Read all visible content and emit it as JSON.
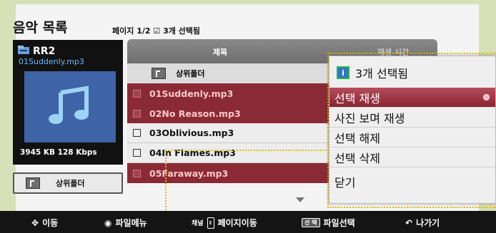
{
  "screen": {
    "title": "음악 목록",
    "page_info": "페이지 1/2",
    "selected_count": "3개 선택됨"
  },
  "now_playing": {
    "title": "RR2",
    "file": "01Suddenly.mp3",
    "info": "3945 KB 128 Kbps",
    "icon": "music-note-icon"
  },
  "up_button": {
    "label": "상위폴더"
  },
  "list": {
    "header_col1": "제목",
    "header_col2": "재생 시간",
    "up_folder": "상위폴더",
    "rows": [
      {
        "name": "01Suddenly.mp3",
        "checked": true
      },
      {
        "name": "02No Reason.mp3",
        "checked": true
      },
      {
        "name": "03Oblivious.mp3",
        "checked": false
      },
      {
        "name": "04In Flames.mp3",
        "checked": false
      },
      {
        "name": "05Faraway.mp3",
        "checked": true
      }
    ]
  },
  "menu": {
    "header": "3개 선택됨",
    "items": [
      "선택 재생",
      "사진 보며 재생",
      "선택 해제",
      "선택 삭제"
    ],
    "close": "닫기"
  },
  "bottom_bar": {
    "move": "이동",
    "file_menu": "파일메뉴",
    "channel_label": "채널",
    "page_move": "페이지이동",
    "select_key": "선 택",
    "file_select": "파일선택",
    "exit": "나가기"
  },
  "colors": {
    "selected_row": "#8a2a35",
    "menu_active": "#a13a48",
    "accent_dotted": "#e2b800"
  }
}
